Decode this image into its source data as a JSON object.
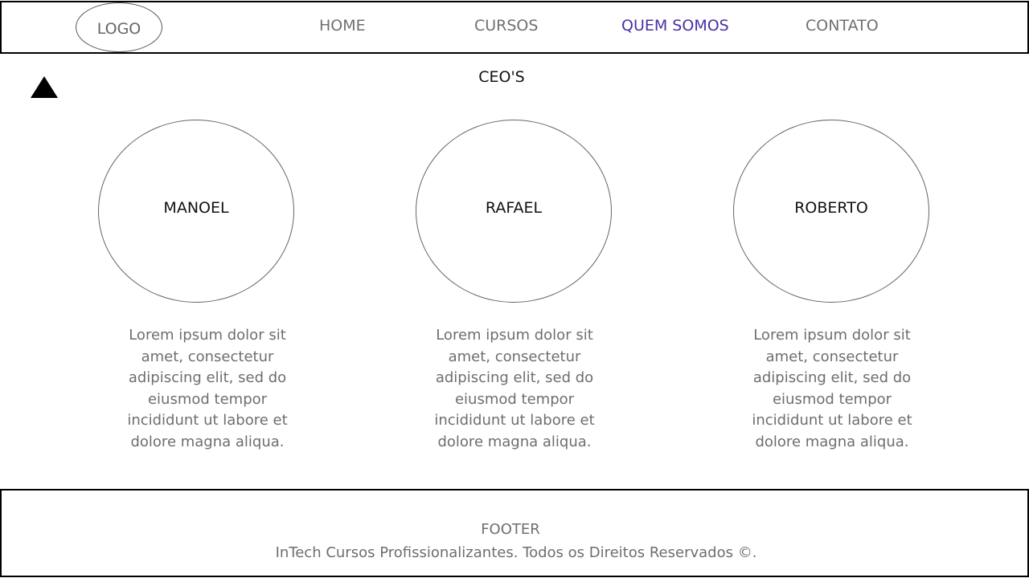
{
  "nav": {
    "logo": "LOGO",
    "links": [
      "HOME",
      "CURSOS",
      "QUEM SOMOS",
      "CONTATO"
    ],
    "active_link": "QUEM SOMOS",
    "active_color": "#4b2fa3"
  },
  "scroll_top_icon": "triangle-up-icon",
  "section": {
    "title": "CEO'S"
  },
  "ceos": [
    {
      "name": "MANOEL",
      "description": "Lorem ipsum dolor sit amet, consectetur adipiscing elit, sed do eiusmod tempor incididunt ut labore et dolore magna aliqua."
    },
    {
      "name": "RAFAEL",
      "description": "Lorem ipsum dolor sit amet, consectetur adipiscing elit, sed do eiusmod tempor incididunt ut labore et dolore magna aliqua."
    },
    {
      "name": "ROBERTO",
      "description": "Lorem ipsum dolor sit amet, consectetur adipiscing elit, sed do eiusmod tempor incididunt ut labore et dolore magna aliqua."
    }
  ],
  "footer": {
    "title": "FOOTER",
    "copyright": "InTech Cursos Profissionalizantes. Todos os Direitos Reservados ©."
  }
}
